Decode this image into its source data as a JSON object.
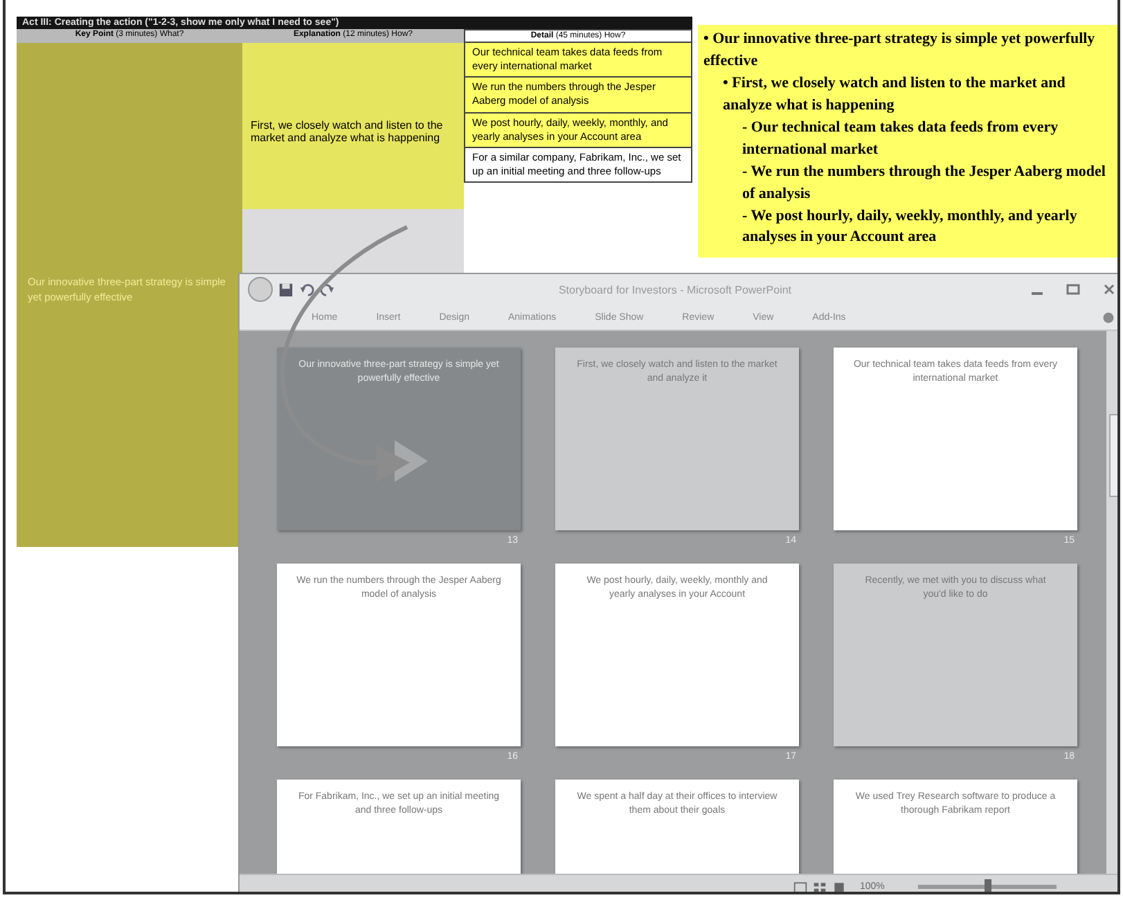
{
  "storyboard_table": {
    "title": "Act III: Creating the action (\"1-2-3, show me only what I need to see\")",
    "columns": [
      {
        "label": "Key Point",
        "note": "(3 minutes) What?"
      },
      {
        "label": "Explanation",
        "note": "(12 minutes) How?"
      },
      {
        "label": "Detail",
        "note": "(45 minutes) How?"
      }
    ],
    "key_point": "Our innovative three-part strategy is simple yet powerfully effective",
    "explanation": "First, we closely watch and listen to the market and analyze what is happening",
    "details": [
      {
        "text": "Our technical team takes data feeds from every international market",
        "highlighted": true
      },
      {
        "text": "We run the numbers through the Jesper Aaberg model of analysis",
        "highlighted": true
      },
      {
        "text": "We post hourly, daily, weekly, monthly, and yearly analyses in your Account area",
        "highlighted": true
      },
      {
        "text": "For a similar company, Fabrikam, Inc., we set up an initial meeting and three follow-ups",
        "highlighted": false
      }
    ]
  },
  "outline_note": {
    "items": [
      {
        "text": "• Our innovative three-part strategy is simple yet powerfully effective",
        "children": [
          {
            "text": "• First, we closely watch and listen to the market and analyze what is happening",
            "children": [
              {
                "text": "- Our technical team takes data feeds from every international market"
              },
              {
                "text": "- We run the numbers through the Jesper Aaberg model of analysis"
              },
              {
                "text": "- We post hourly, daily, weekly, monthly, and yearly analyses in your Account area"
              }
            ]
          }
        ]
      }
    ]
  },
  "powerpoint": {
    "title": "Storyboard for Investors - Microsoft PowerPoint",
    "ribbon_tabs": [
      "Home",
      "Insert",
      "Design",
      "Animations",
      "Slide Show",
      "Review",
      "View",
      "Add-Ins"
    ],
    "slides": [
      {
        "text": "Our innovative three-part strategy is simple yet powerfully effective",
        "number": "13",
        "selected": true,
        "hidden": false
      },
      {
        "text": "First, we closely watch and listen to the market and analyze it",
        "number": "14",
        "selected": false,
        "hidden": true
      },
      {
        "text": "Our technical team takes data feeds from every international market",
        "number": "15",
        "selected": false,
        "hidden": false
      },
      {
        "text": "We run the numbers through the Jesper Aaberg model of analysis",
        "number": "16",
        "selected": false,
        "hidden": false
      },
      {
        "text": "We post hourly, daily, weekly, monthly and yearly analyses in your Account",
        "number": "17",
        "selected": false,
        "hidden": false
      },
      {
        "text": "Recently, we met with you to discuss what you'd like to do",
        "number": "18",
        "selected": false,
        "hidden": true
      },
      {
        "text": "For Fabrikam, Inc., we set up an initial meeting and three follow-ups",
        "selected": false,
        "hidden": false
      },
      {
        "text": "We spent a half day at their offices to interview them about their goals",
        "selected": false,
        "hidden": false
      },
      {
        "text": "We used Trey Research software to produce a thorough Fabrikam report",
        "selected": false,
        "hidden": false
      }
    ],
    "zoom": "100%",
    "zoom_slider": {
      "level": 0.5
    }
  }
}
